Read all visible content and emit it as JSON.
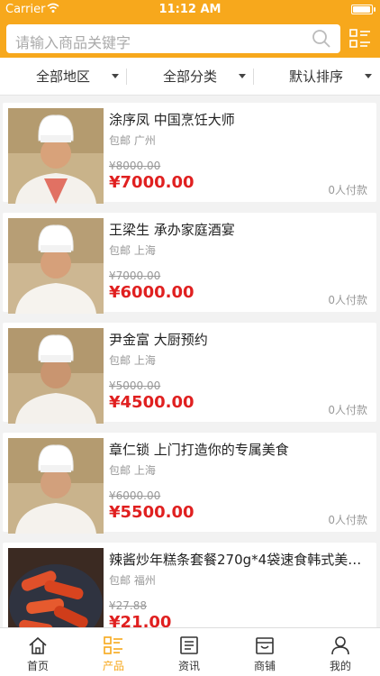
{
  "status": {
    "carrier": "Carrier",
    "time": "11:12 AM",
    "battery_level": 0.95
  },
  "search": {
    "placeholder": "请输入商品关键字"
  },
  "filters": [
    {
      "label": "全部地区"
    },
    {
      "label": "全部分类"
    },
    {
      "label": "默认排序"
    }
  ],
  "items": [
    {
      "title": "涂序凤 中国烹饪大师",
      "location": "包邮 广州",
      "old_price": "¥8000.00",
      "price": "¥7000.00",
      "paid": "0人付款",
      "image": "chef-portrait"
    },
    {
      "title": "王梁生 承办家庭酒宴",
      "location": "包邮 上海",
      "old_price": "¥7000.00",
      "price": "¥6000.00",
      "paid": "0人付款",
      "image": "chef-portrait"
    },
    {
      "title": "尹金富 大厨预约",
      "location": "包邮 上海",
      "old_price": "¥5000.00",
      "price": "¥4500.00",
      "paid": "0人付款",
      "image": "chef-portrait"
    },
    {
      "title": "章仁锁 上门打造你的专属美食",
      "location": "包邮 上海",
      "old_price": "¥6000.00",
      "price": "¥5500.00",
      "paid": "0人付款",
      "image": "chef-portrait"
    },
    {
      "title": "辣酱炒年糕条套餐270g*4袋速食韩式美…",
      "location": "包邮 福州",
      "old_price": "¥27.88",
      "price": "¥21.00",
      "paid": "",
      "image": "rice-cake-dish"
    }
  ],
  "tabs": [
    {
      "label": "首页",
      "icon": "home-icon",
      "active": false
    },
    {
      "label": "产品",
      "icon": "grid-list-icon",
      "active": true
    },
    {
      "label": "资讯",
      "icon": "news-icon",
      "active": false
    },
    {
      "label": "商铺",
      "icon": "shop-icon",
      "active": false
    },
    {
      "label": "我的",
      "icon": "user-icon",
      "active": false
    }
  ],
  "colors": {
    "accent": "#f7a81c",
    "price": "#e02020",
    "tab_inactive": "#333333"
  }
}
